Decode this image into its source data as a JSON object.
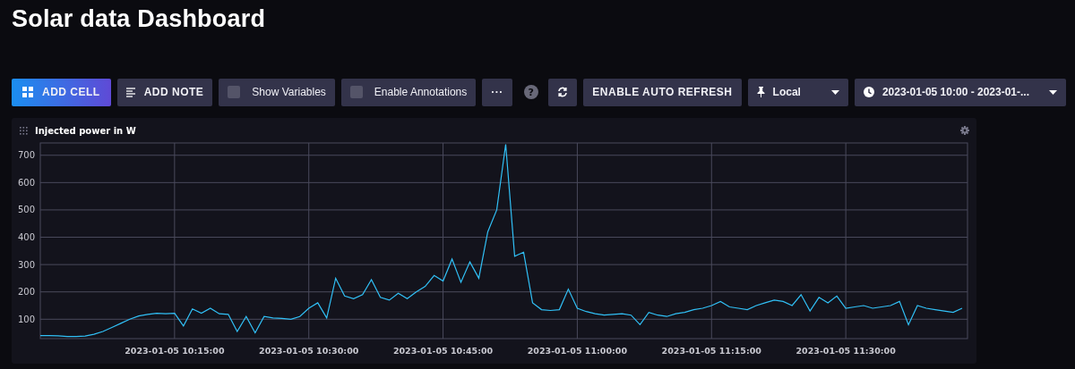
{
  "title": "Solar data Dashboard",
  "toolbar_left": [
    {
      "kind": "primary",
      "label": "ADD CELL"
    },
    {
      "kind": "button",
      "label": "ADD NOTE"
    },
    {
      "kind": "toggle",
      "label": "Show Variables",
      "checked": false
    },
    {
      "kind": "toggle",
      "label": "Enable Annotations",
      "checked": false
    },
    {
      "kind": "button",
      "label": "···"
    },
    {
      "kind": "help",
      "label": "?"
    }
  ],
  "toolbar_right": [
    {
      "kind": "button"
    },
    {
      "kind": "button",
      "label": "ENABLE AUTO REFRESH"
    },
    {
      "kind": "dropdown",
      "label": "Local"
    },
    {
      "kind": "dropdown",
      "label": "2023-01-05 10:00 - 2023-01-..."
    }
  ],
  "panel": {
    "title": "Injected power in W",
    "chart_data": {
      "type": "line",
      "grid": true,
      "ylim": [
        29,
        745
      ],
      "yticks": [
        100,
        200,
        300,
        400,
        500,
        600,
        700
      ],
      "categories": [
        null,
        null,
        null,
        null,
        null,
        null,
        null,
        null,
        null,
        null,
        null,
        null,
        null,
        null,
        null,
        "2023-01-05 10:15:00",
        null,
        null,
        null,
        null,
        null,
        null,
        null,
        null,
        null,
        null,
        null,
        null,
        null,
        null,
        "2023-01-05 10:30:00",
        null,
        null,
        null,
        null,
        null,
        null,
        null,
        null,
        null,
        null,
        null,
        null,
        null,
        null,
        "2023-01-05 10:45:00",
        null,
        null,
        null,
        null,
        null,
        null,
        null,
        null,
        null,
        null,
        null,
        null,
        null,
        null,
        "2023-01-05 11:00:00",
        null,
        null,
        null,
        null,
        null,
        null,
        null,
        null,
        null,
        null,
        null,
        null,
        null,
        null,
        "2023-01-05 11:15:00",
        null,
        null,
        null,
        null,
        null,
        null,
        null,
        null,
        null,
        null,
        null,
        null,
        null,
        null,
        "2023-01-05 11:30:00",
        null,
        null,
        null,
        null,
        null,
        null,
        null,
        null,
        null,
        null,
        null,
        null,
        null
      ],
      "series": [
        {
          "color": "#31c0f6",
          "values": [
            40,
            40,
            39,
            37,
            37,
            38,
            45,
            55,
            70,
            85,
            100,
            112,
            118,
            122,
            120,
            122,
            75,
            138,
            122,
            140,
            120,
            118,
            55,
            110,
            50,
            110,
            105,
            103,
            100,
            110,
            140,
            160,
            105,
            250,
            185,
            175,
            190,
            245,
            180,
            170,
            195,
            175,
            200,
            220,
            260,
            240,
            320,
            235,
            310,
            250,
            420,
            500,
            740,
            330,
            345,
            160,
            135,
            132,
            135,
            210,
            140,
            128,
            120,
            115,
            118,
            120,
            115,
            80,
            125,
            115,
            110,
            120,
            125,
            135,
            140,
            150,
            165,
            145,
            140,
            135,
            150,
            160,
            170,
            165,
            150,
            190,
            130,
            180,
            160,
            185,
            140,
            145,
            150,
            140,
            145,
            150,
            165,
            80,
            150,
            140,
            135,
            130,
            125,
            140
          ]
        }
      ]
    }
  }
}
